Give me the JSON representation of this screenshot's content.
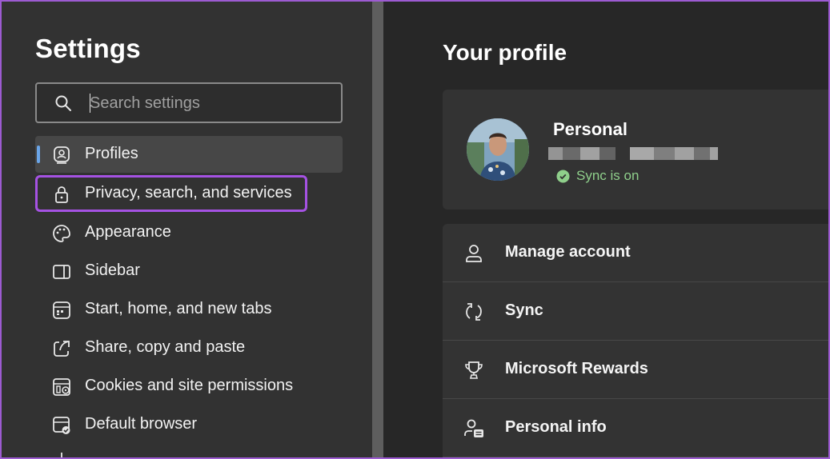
{
  "sidebar": {
    "title": "Settings",
    "search": {
      "placeholder": "Search settings",
      "value": ""
    },
    "items": [
      {
        "label": "Profiles",
        "icon": "profiles-icon",
        "selected": true
      },
      {
        "label": "Privacy, search, and services",
        "icon": "lock-icon",
        "highlighted": true
      },
      {
        "label": "Appearance",
        "icon": "palette-icon"
      },
      {
        "label": "Sidebar",
        "icon": "sidebar-icon"
      },
      {
        "label": "Start, home, and new tabs",
        "icon": "home-tabs-icon"
      },
      {
        "label": "Share, copy and paste",
        "icon": "share-icon"
      },
      {
        "label": "Cookies and site permissions",
        "icon": "cookies-icon"
      },
      {
        "label": "Default browser",
        "icon": "default-browser-icon"
      }
    ]
  },
  "main": {
    "heading": "Your profile",
    "profile": {
      "name": "Personal",
      "sync_status": "Sync is on"
    },
    "rows": [
      {
        "label": "Manage account",
        "icon": "person-icon"
      },
      {
        "label": "Sync",
        "icon": "sync-icon"
      },
      {
        "label": "Microsoft Rewards",
        "icon": "trophy-icon"
      },
      {
        "label": "Personal info",
        "icon": "personal-info-icon"
      }
    ]
  },
  "colors": {
    "highlight_border": "#a552e3",
    "selected_indicator": "#6aa5e8",
    "sync_green": "#8fcf8b"
  }
}
